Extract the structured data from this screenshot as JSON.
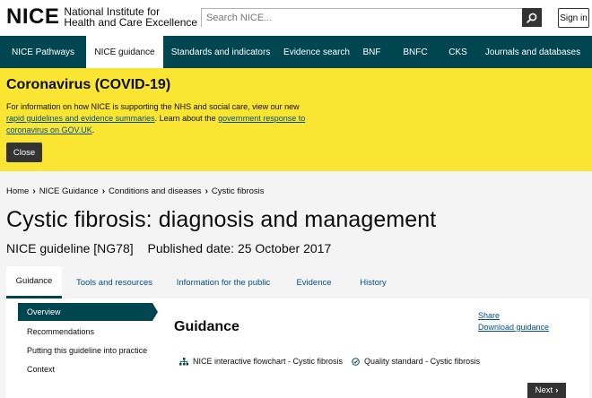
{
  "header": {
    "logo_short": "NICE",
    "logo_line1": "National Institute for",
    "logo_line2": "Health and Care Excellence",
    "search_placeholder": "Search NICE...",
    "signin_label": "Sign in"
  },
  "nav": {
    "items": [
      {
        "label": "NICE Pathways"
      },
      {
        "label": "NICE guidance"
      },
      {
        "label": "Standards and indicators"
      },
      {
        "label": "Evidence search"
      },
      {
        "label": "BNF"
      },
      {
        "label": "BNFC"
      },
      {
        "label": "CKS"
      },
      {
        "label": "Journals and databases"
      }
    ]
  },
  "banner": {
    "heading": "Coronavirus (COVID-19)",
    "text_1": "For information on how NICE is supporting the NHS and social care, view our new ",
    "link_1": "rapid guidelines and evidence summaries",
    "text_2": ". Learn about the ",
    "link_2": "government response to coronavirus on GOV.UK",
    "text_3": ".",
    "close_label": "Close"
  },
  "breadcrumb": [
    "Home",
    "NICE Guidance",
    "Conditions and diseases",
    "Cystic fibrosis"
  ],
  "page": {
    "title": "Cystic fibrosis: diagnosis and management",
    "guideline_ref": "NICE guideline [NG78]",
    "published": "Published date: 25 October 2017"
  },
  "tabs": [
    {
      "label": "Guidance"
    },
    {
      "label": "Tools and resources"
    },
    {
      "label": "Information for the public"
    },
    {
      "label": "Evidence"
    },
    {
      "label": "History"
    }
  ],
  "sidebar": {
    "items": [
      {
        "label": "Overview"
      },
      {
        "label": "Recommendations"
      },
      {
        "label": "Putting this guideline into practice"
      },
      {
        "label": "Context"
      }
    ]
  },
  "main": {
    "heading": "Guidance",
    "share": "Share",
    "download": "Download guidance",
    "related_1": "NICE interactive flowchart - Cystic fibrosis",
    "related_2": "Quality standard - Cystic fibrosis",
    "next_label": "Next"
  },
  "colors": {
    "nav_bg": "#004650",
    "banner_bg": "#fae632",
    "link": "#004f8c"
  }
}
